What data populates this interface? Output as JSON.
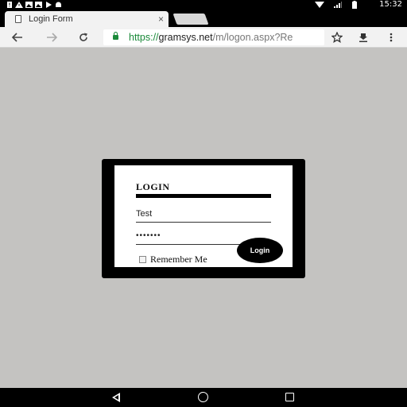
{
  "status_bar": {
    "time": "15:32",
    "icons": [
      "alert-icon",
      "warning-icon",
      "photo-icon",
      "photo-icon",
      "play-store-icon",
      "android-icon",
      "wifi-icon",
      "signal-icon",
      "battery-icon"
    ]
  },
  "browser": {
    "tab": {
      "title": "Login Form",
      "close_label": "×"
    },
    "toolbar": {
      "back_icon": "arrow-left-icon",
      "forward_icon": "arrow-right-icon",
      "reload_icon": "reload-icon",
      "bookmark_icon": "star-icon",
      "download_icon": "download-icon",
      "menu_icon": "menu-icon"
    },
    "url": {
      "scheme": "https://",
      "host": "gramsys.net",
      "path": "/m/logon.aspx?Re"
    }
  },
  "login": {
    "title": "LOGIN",
    "username_value": "Test",
    "password_value": "•••••••",
    "remember_label": "Remember Me",
    "remember_checked": false,
    "button_label": "Login"
  },
  "nav_bar": {
    "back_icon": "nav-back-icon",
    "home_icon": "nav-home-icon",
    "recents_icon": "nav-recents-icon"
  },
  "colors": {
    "page_background": "#c4c3c1",
    "card_border": "#000000",
    "secure_green": "#1a8a39"
  }
}
